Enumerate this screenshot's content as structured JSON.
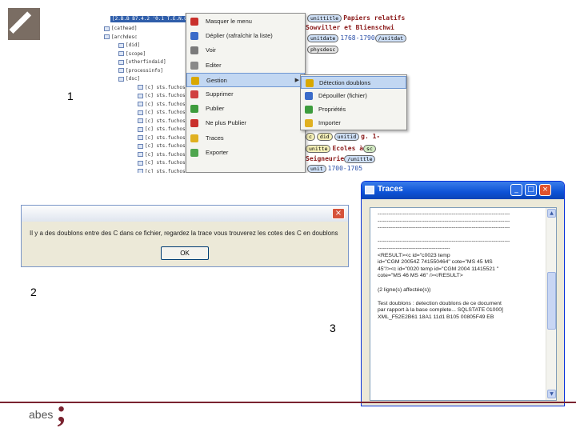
{
  "slide": {
    "labels": [
      "1",
      "2",
      "3"
    ],
    "footer_brand": "abes",
    "footer_mark": ";"
  },
  "shot1": {
    "tree_header": "[2.B.B B7.4.2 '0.1 T.E.N.O.S   'tu.ch",
    "tree_items": [
      "[cathead]",
      "[archdesc",
      "[did]",
      "[scope]",
      "[otherfindaid]",
      "[processinfo]",
      "[dsc]",
      "[c] sts.fuchos",
      "[c] sts.fuchos",
      "[c] sts.fuchos",
      "[c] sts.fuchos",
      "[c] sts.fuchos",
      "[c] sts.fuchos",
      "[c] sts.fuchos",
      "[c] sts.fuchos",
      "[c] sts.fuchos",
      "[c] sts.fuchos",
      "[c] sts.fuchos"
    ],
    "menu": [
      {
        "label": "Masquer le menu",
        "icon": "close-red-icon",
        "color": "#c9302c"
      },
      {
        "label": "Déplier (rafraîchir la liste)",
        "icon": "check-blue-icon",
        "color": "#3a6bc9"
      },
      {
        "label": "Voir",
        "icon": "view-icon",
        "color": "#7a7a7a"
      },
      {
        "label": "Editer",
        "icon": "edit-icon",
        "color": "#8a8a8a"
      },
      {
        "label": "Gestion",
        "icon": "manage-icon",
        "color": "#d9a800",
        "has_submenu": true,
        "highlighted": true
      },
      {
        "label": "Supprimer",
        "icon": "delete-icon",
        "color": "#d04040"
      },
      {
        "label": "Publier",
        "icon": "publish-icon",
        "color": "#3d9c3d"
      },
      {
        "label": "Ne plus Publier",
        "icon": "unpublish-icon",
        "color": "#c9302c"
      },
      {
        "label": "Traces",
        "icon": "traces-icon",
        "color": "#e0b020"
      },
      {
        "label": "Exporter",
        "icon": "export-icon",
        "color": "#4fa64f"
      }
    ],
    "submenu": [
      {
        "label": "Détection doublons",
        "icon": "duplicates-icon",
        "color": "#d9a800",
        "highlighted": true
      },
      {
        "label": "Dépouiller (fichier)",
        "icon": "extract-icon",
        "color": "#3a6bc9"
      },
      {
        "label": "Propriétés",
        "icon": "properties-icon",
        "color": "#3d9c3d"
      },
      {
        "label": "Importer",
        "icon": "import-icon",
        "color": "#e0b020"
      }
    ],
    "xml": {
      "row1_tag": "unittitle",
      "row1_text": "Papiers relatifs",
      "row2_text": "Sowviller et Blienschwi",
      "row3_tag": "unitdate",
      "row3_text": "1768-1790",
      "row3_tag_end": "/unitdat",
      "row4_tag": "physdesc",
      "row5_text": "g. 1-",
      "row5_tag_a": "c",
      "row5_tag_b": "did",
      "row5_tag_c": "unitid",
      "row6_tag": "unitte",
      "row6_text": "Ecoles à",
      "row6_tag_end": "sc",
      "row7_text": "Seigneurie",
      "row7_tag_end": "/unittle",
      "row8_text": "1700-1705",
      "row8_tag": "unit"
    }
  },
  "dialog": {
    "message": "Il y a des doublons entre des C dans ce fichier, regardez la trace vous trouverez les cotes des C en doublons",
    "ok_label": "OK",
    "close_glyph": "×"
  },
  "traces": {
    "title": "Traces",
    "min_glyph": "_",
    "max_glyph": "□",
    "close_glyph": "×",
    "lines": [
      "-------------------------------------------------------------------------",
      "-------------------------------------------------------------------------",
      "-------------------------------------------------------------------------",
      "",
      "-------------------------------------------------------------------------",
      "----------------------------------------",
      "<RESULT><c id=\"c0023 temp",
      "id=\"CGM 20054Z 741550464\" cote=\"MS 45 MS",
      "45\"/><c id=\"0020 temp id=\"CGM 2004 11415521 \"",
      "cote=\"MS 46 MS 46\" /></RESULT>",
      "",
      "(2 ligne(s) affectée(s))",
      "",
      "Test doublons : detection doublons de ce document",
      "par rapport à la base complete... SQLSTATE 01000]",
      "XML_F52E2B61 18A1 11d1 B105 00805F49 EB"
    ]
  }
}
